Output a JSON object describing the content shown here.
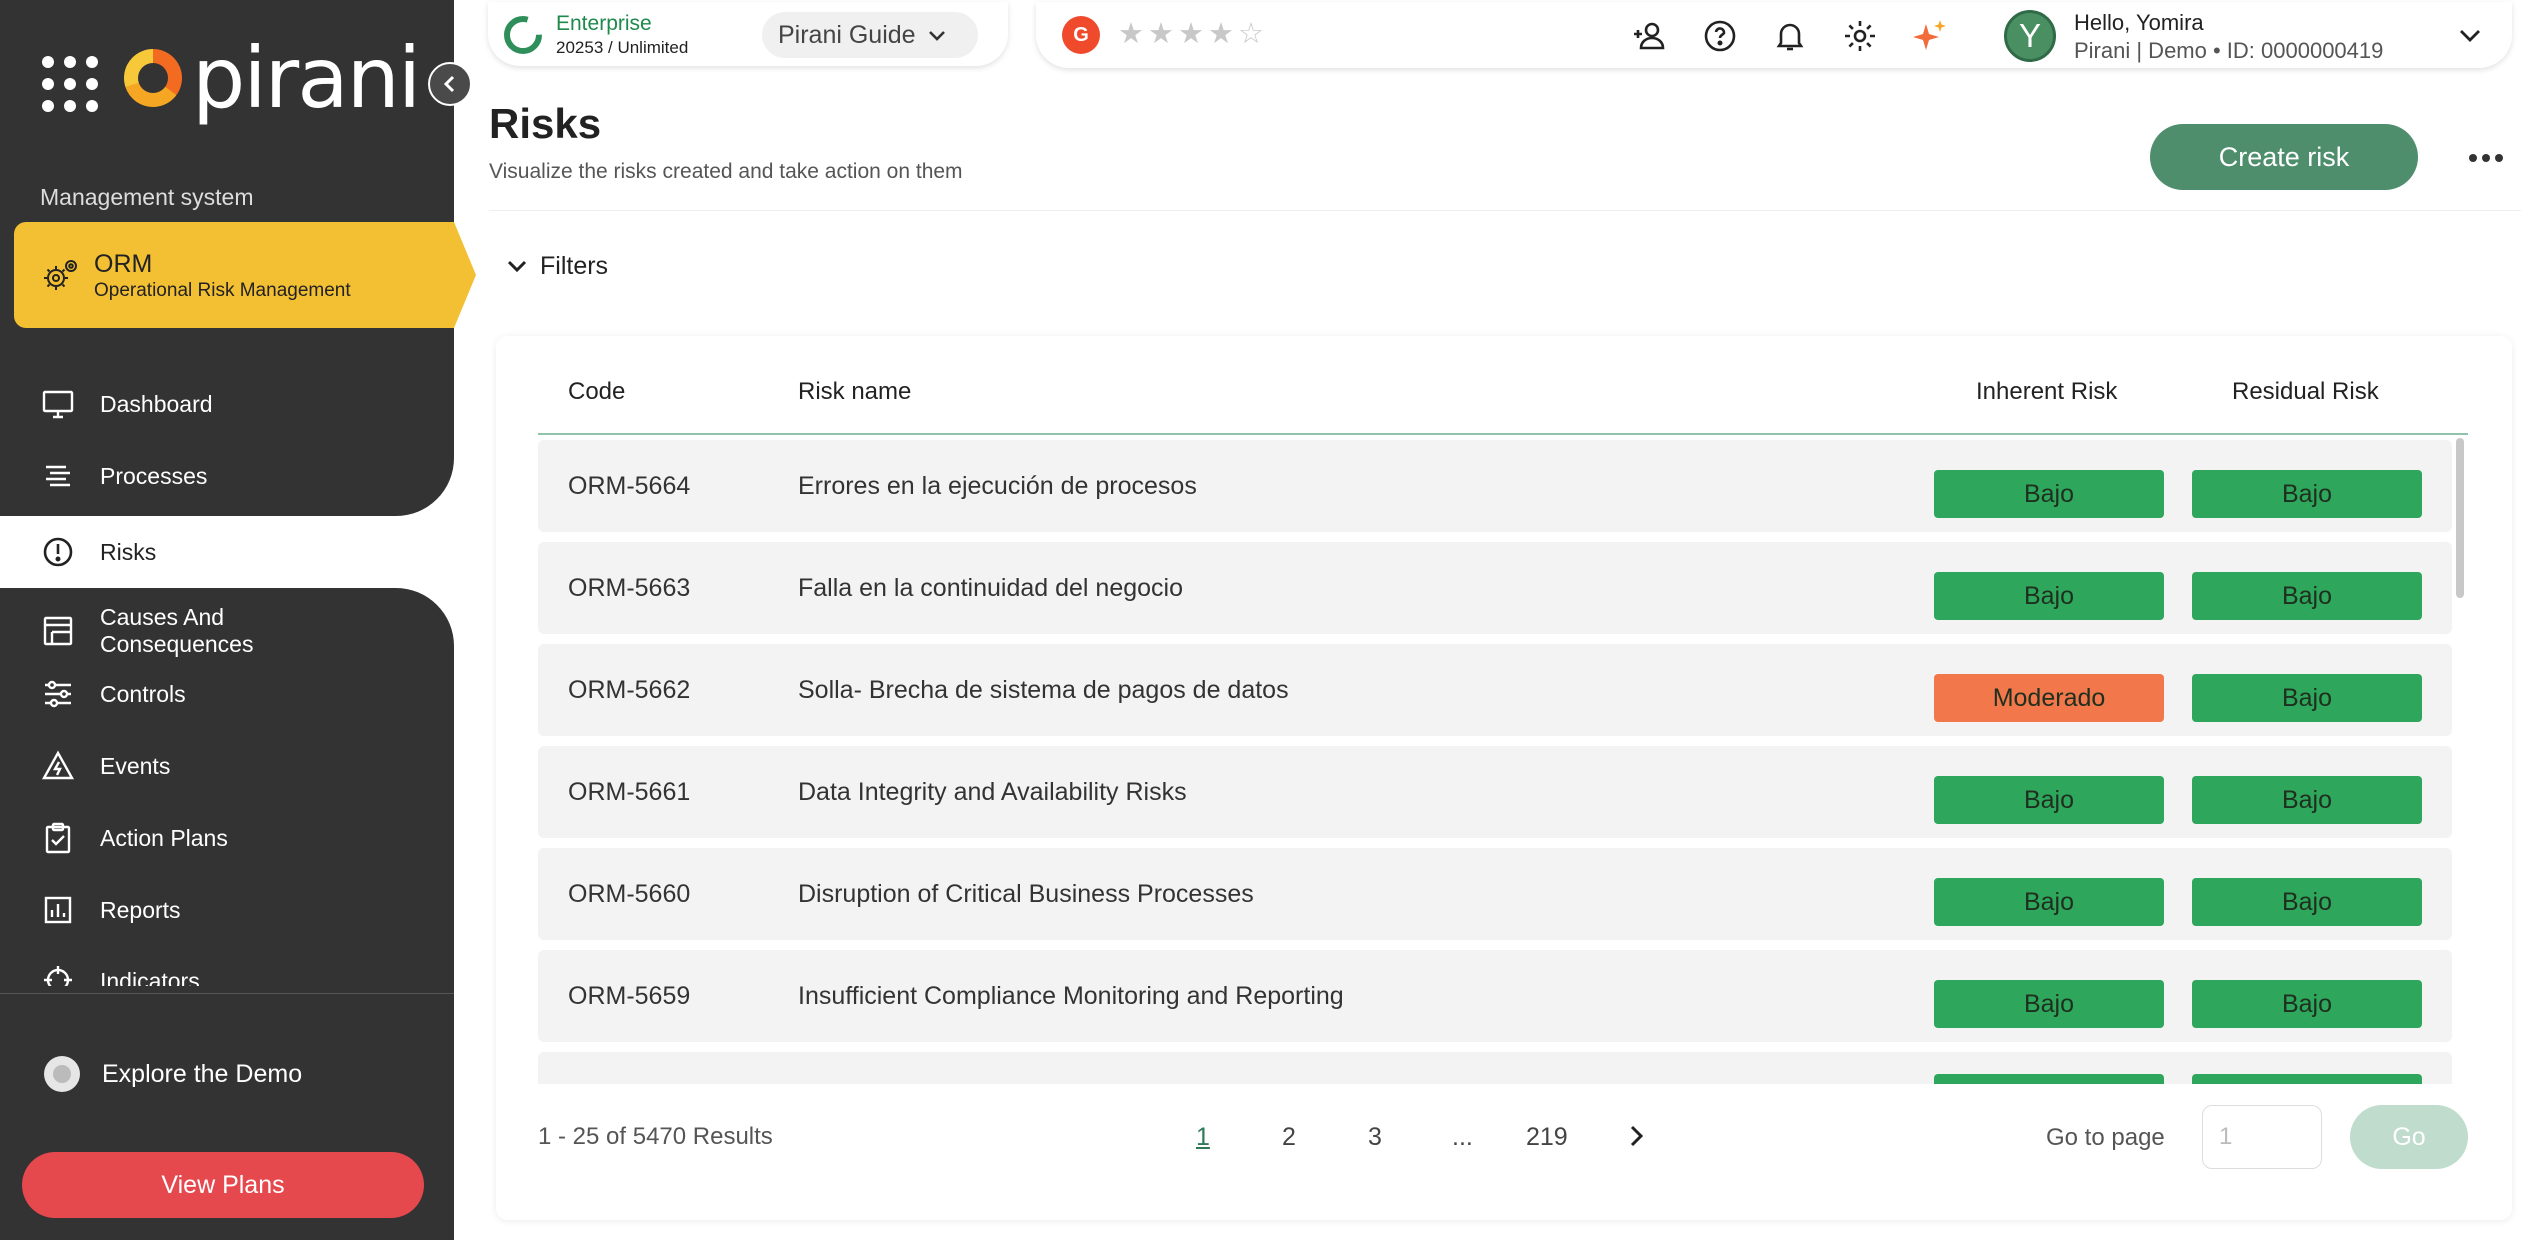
{
  "sidebar": {
    "logo_text": "pirani",
    "section_label": "Management system",
    "module": {
      "title": "ORM",
      "subtitle": "Operational Risk Management"
    },
    "items": [
      {
        "label": "Dashboard",
        "icon": "monitor-icon"
      },
      {
        "label": "Processes",
        "icon": "list-icon"
      },
      {
        "label": "Risks",
        "icon": "alert-circle-icon"
      },
      {
        "label": "Causes And Consequences",
        "icon": "layers-icon"
      },
      {
        "label": "Controls",
        "icon": "sliders-icon"
      },
      {
        "label": "Events",
        "icon": "warning-triangle-icon"
      },
      {
        "label": "Action Plans",
        "icon": "clipboard-check-icon"
      },
      {
        "label": "Reports",
        "icon": "bar-chart-icon"
      },
      {
        "label": "Indicators",
        "icon": "target-icon"
      }
    ],
    "active_item": "Risks",
    "explore": "Explore the Demo",
    "view_plans": "View Plans"
  },
  "topbar": {
    "plan_name": "Enterprise",
    "plan_usage": "20253 / Unlimited",
    "guide": "Pirani Guide",
    "stars": "★★★★☆",
    "user_initial": "Y",
    "greeting": "Hello, Yomira",
    "user_sub": "Pirani | Demo • ID: 0000000419"
  },
  "header": {
    "title": "Risks",
    "subtitle": "Visualize the risks created and take action on them",
    "create_button": "Create risk"
  },
  "filters": {
    "label": "Filters"
  },
  "table": {
    "columns": [
      "Code",
      "Risk name",
      "Inherent Risk",
      "Residual Risk"
    ],
    "rows": [
      {
        "code": "ORM-5664",
        "name": "Errores en la ejecución de procesos",
        "inherent": "Bajo",
        "residual": "Bajo"
      },
      {
        "code": "ORM-5663",
        "name": "Falla en la continuidad del negocio",
        "inherent": "Bajo",
        "residual": "Bajo"
      },
      {
        "code": "ORM-5662",
        "name": "Solla- Brecha de sistema de pagos de datos",
        "inherent": "Moderado",
        "residual": "Bajo"
      },
      {
        "code": "ORM-5661",
        "name": "Data Integrity and Availability Risks",
        "inherent": "Bajo",
        "residual": "Bajo"
      },
      {
        "code": "ORM-5660",
        "name": "Disruption of Critical Business Processes",
        "inherent": "Bajo",
        "residual": "Bajo"
      },
      {
        "code": "ORM-5659",
        "name": "Insufficient Compliance Monitoring and Reporting",
        "inherent": "Bajo",
        "residual": "Bajo"
      },
      {
        "code": "",
        "name": "",
        "inherent": "Bajo",
        "residual": "Bajo"
      }
    ]
  },
  "pagination": {
    "results": "1 - 25 of 5470 Results",
    "pages": [
      "1",
      "2",
      "3",
      "...",
      "219"
    ],
    "current_page": "1",
    "goto_label": "Go to page",
    "goto_placeholder": "1",
    "go_button": "Go"
  },
  "colors": {
    "sidebar_bg": "#333333",
    "module_yellow": "#f4c033",
    "primary_green": "#4e8e6d",
    "risk_low": "#2ea65b",
    "risk_moderate": "#f2784b",
    "view_plans_red": "#e5484d"
  }
}
